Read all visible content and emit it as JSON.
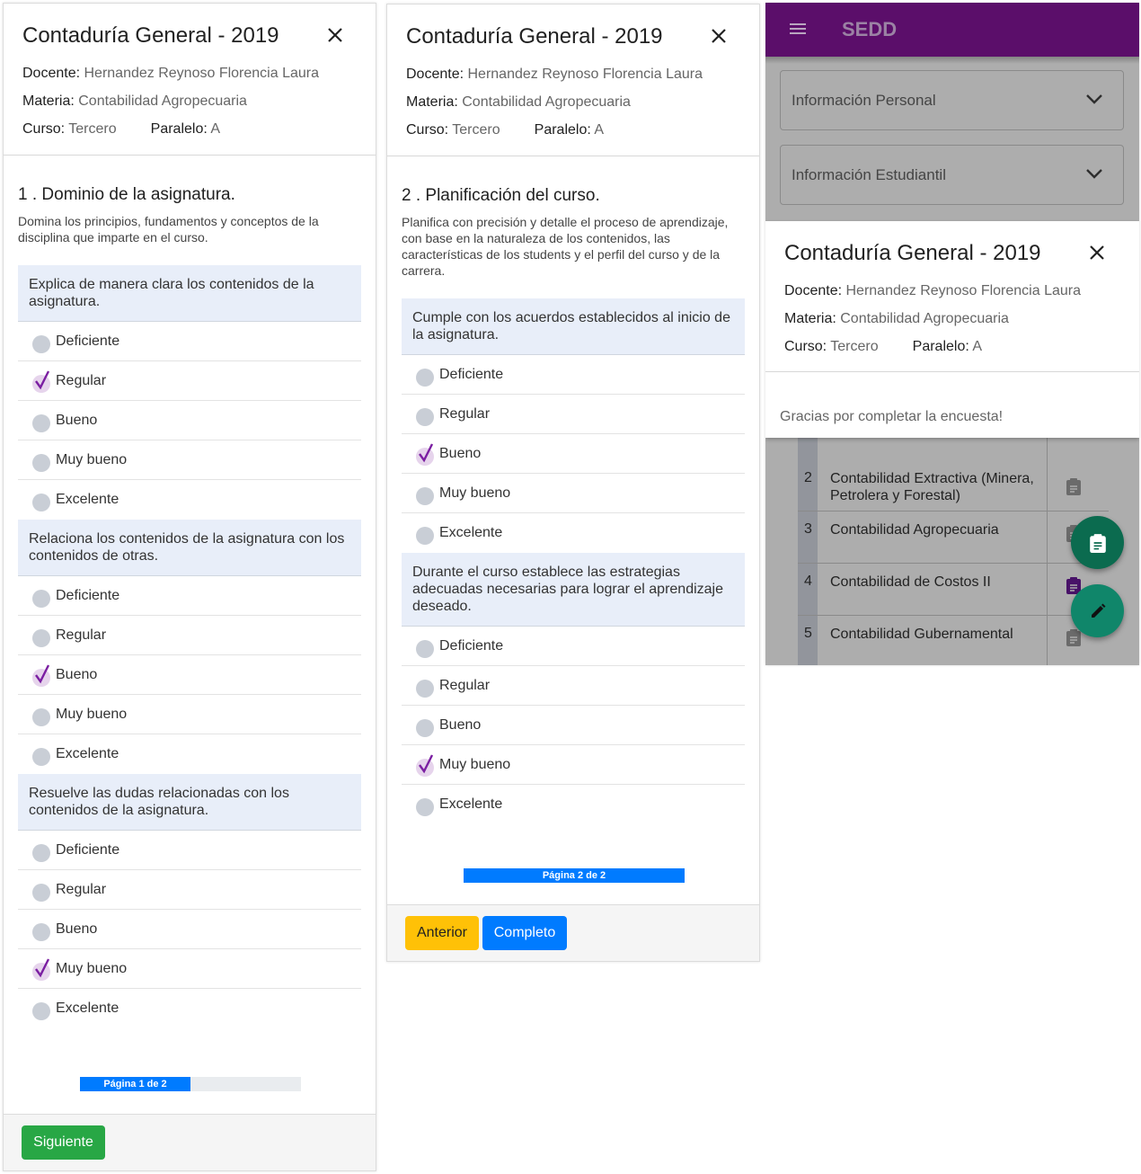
{
  "survey": {
    "title": "Contaduría General - 2019",
    "docente_label": "Docente:",
    "docente": "Hernandez Reynoso Florencia Laura",
    "materia_label": "Materia:",
    "materia": "Contabilidad Agropecuaria",
    "curso_label": "Curso:",
    "curso": "Tercero",
    "paralelo_label": "Paralelo:",
    "paralelo": "A"
  },
  "page1": {
    "section_title": "1 .  Dominio de la asignatura.",
    "section_desc": "Domina los principios, fundamentos y conceptos de la disciplina que imparte en el curso.",
    "questions": [
      {
        "text": "Explica de manera clara los contenidos de la asignatura.",
        "selected": "Regular"
      },
      {
        "text": "Relaciona los contenidos de la asignatura con los contenidos de otras.",
        "selected": "Bueno"
      },
      {
        "text": "Resuelve las dudas relacionadas con los contenidos de la asignatura.",
        "selected": "Muy bueno"
      }
    ],
    "progress_label": "Página 1 de 2",
    "progress_value": 0.5,
    "next_button": "Siguiente"
  },
  "page2": {
    "section_title": "2 .  Planificación del curso.",
    "section_desc": "Planifica con precisión y detalle el proceso de aprendizaje, con base en la naturaleza de los contenidos, las características de los students y el perfil del curso y de la carrera.",
    "questions": [
      {
        "text": "Cumple con los acuerdos establecidos al inicio de la asignatura.",
        "selected": "Bueno"
      },
      {
        "text": "Durante el curso establece las estrategias adecuadas necesarias para lograr el aprendizaje deseado.",
        "selected": "Muy bueno"
      }
    ],
    "progress_label": "Página 2 de 2",
    "progress_value": 1.0,
    "prev_button": "Anterior",
    "complete_button": "Completo"
  },
  "options": [
    "Deficiente",
    "Regular",
    "Bueno",
    "Muy bueno",
    "Excelente"
  ],
  "app": {
    "title": "SEDD",
    "accordion_personal": "Información Personal",
    "accordion_student": "Información Estudiantil",
    "thanks": "Gracias por completar la encuesta!",
    "courses": [
      {
        "num": "2",
        "name": "Contabilidad Extractiva (Minera, Petrolera y Forestal)"
      },
      {
        "num": "3",
        "name": "Contabilidad Agropecuaria"
      },
      {
        "num": "4",
        "name": "Contabilidad de Costos II"
      },
      {
        "num": "5",
        "name": "Contabilidad Gubernamental"
      }
    ]
  },
  "colors": {
    "appbar": "#5b0e6a",
    "next_button": "#28a745",
    "prev_button": "#ffc107",
    "complete_button": "#007bff",
    "progress": "#007bff",
    "fab_clipboard": "#0b6b4f",
    "fab_edit": "#10866a"
  }
}
